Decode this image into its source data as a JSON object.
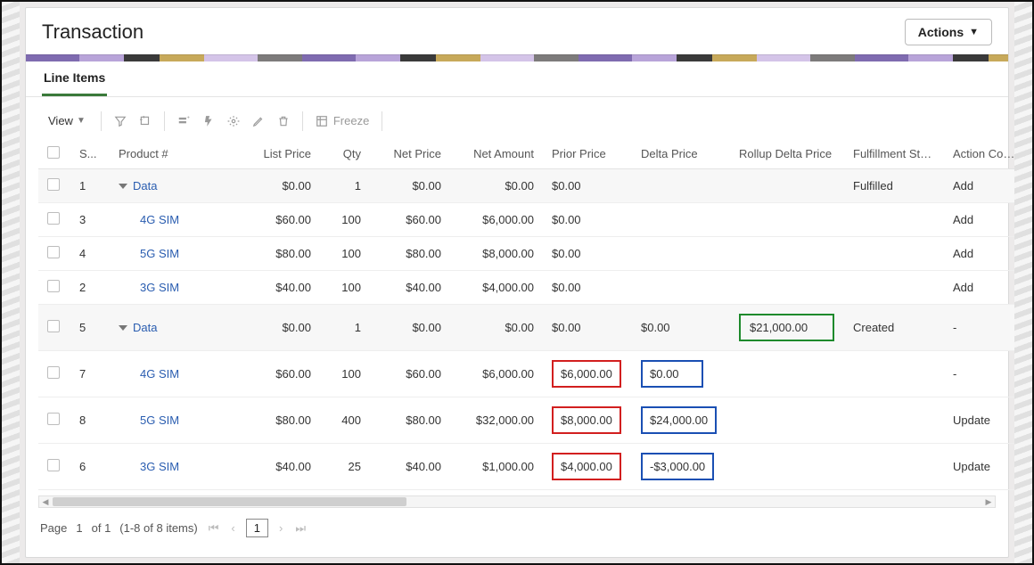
{
  "header": {
    "title": "Transaction",
    "actions_label": "Actions"
  },
  "tab_label": "Line Items",
  "toolbar": {
    "view_label": "View",
    "freeze_label": "Freeze"
  },
  "columns": {
    "seq": "S...",
    "product": "Product #",
    "list_price": "List Price",
    "qty": "Qty",
    "net_price": "Net Price",
    "net_amount": "Net Amount",
    "prior_price": "Prior Price",
    "delta_price": "Delta Price",
    "rollup_delta_price": "Rollup Delta Price",
    "fulfillment_status": "Fulfillment Stat...",
    "action_code": "Action Code"
  },
  "rows": [
    {
      "seq": "1",
      "product": "Data",
      "group": true,
      "list_price": "$0.00",
      "qty": "1",
      "net_price": "$0.00",
      "net_amount": "$0.00",
      "prior_price": "$0.00",
      "delta_price": "",
      "rollup_delta": "",
      "fstatus": "Fulfilled",
      "acode": "Add",
      "alt": true
    },
    {
      "seq": "3",
      "product": "4G SIM",
      "group": false,
      "list_price": "$60.00",
      "qty": "100",
      "net_price": "$60.00",
      "net_amount": "$6,000.00",
      "prior_price": "$0.00",
      "delta_price": "",
      "rollup_delta": "",
      "fstatus": "",
      "acode": "Add",
      "alt": false
    },
    {
      "seq": "4",
      "product": "5G SIM",
      "group": false,
      "list_price": "$80.00",
      "qty": "100",
      "net_price": "$80.00",
      "net_amount": "$8,000.00",
      "prior_price": "$0.00",
      "delta_price": "",
      "rollup_delta": "",
      "fstatus": "",
      "acode": "Add",
      "alt": false
    },
    {
      "seq": "2",
      "product": "3G SIM",
      "group": false,
      "list_price": "$40.00",
      "qty": "100",
      "net_price": "$40.00",
      "net_amount": "$4,000.00",
      "prior_price": "$0.00",
      "delta_price": "",
      "rollup_delta": "",
      "fstatus": "",
      "acode": "Add",
      "alt": false
    },
    {
      "seq": "5",
      "product": "Data",
      "group": true,
      "list_price": "$0.00",
      "qty": "1",
      "net_price": "$0.00",
      "net_amount": "$0.00",
      "prior_price": "$0.00",
      "delta_price": "$0.00",
      "rollup_delta": "$21,000.00",
      "rollup_hi": "green",
      "fstatus": "Created",
      "acode": "-",
      "alt": true
    },
    {
      "seq": "7",
      "product": "4G SIM",
      "group": false,
      "list_price": "$60.00",
      "qty": "100",
      "net_price": "$60.00",
      "net_amount": "$6,000.00",
      "prior_price": "$6,000.00",
      "prior_hi": "red",
      "delta_price": "$0.00",
      "delta_hi": "blue",
      "rollup_delta": "",
      "fstatus": "",
      "acode": "-",
      "alt": false
    },
    {
      "seq": "8",
      "product": "5G SIM",
      "group": false,
      "list_price": "$80.00",
      "qty": "400",
      "net_price": "$80.00",
      "net_amount": "$32,000.00",
      "prior_price": "$8,000.00",
      "prior_hi": "red",
      "delta_price": "$24,000.00",
      "delta_hi": "blue",
      "rollup_delta": "",
      "fstatus": "",
      "acode": "Update",
      "alt": false
    },
    {
      "seq": "6",
      "product": "3G SIM",
      "group": false,
      "list_price": "$40.00",
      "qty": "25",
      "net_price": "$40.00",
      "net_amount": "$1,000.00",
      "prior_price": "$4,000.00",
      "prior_hi": "red",
      "delta_price": "-$3,000.00",
      "delta_hi": "blue",
      "rollup_delta": "",
      "fstatus": "",
      "acode": "Update",
      "alt": false
    }
  ],
  "pager": {
    "page_label": "Page",
    "current": "1",
    "of_label": "of 1",
    "range": "(1-8 of 8 items)"
  }
}
